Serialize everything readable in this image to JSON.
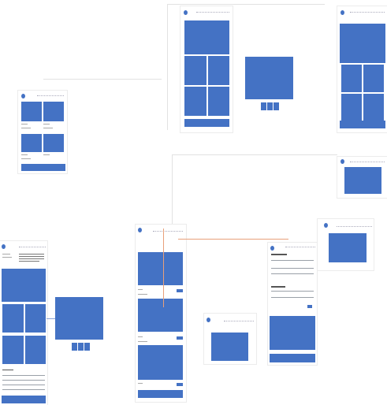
{
  "screens": {
    "top_center_title": "",
    "top_right_title": "",
    "left_title": "",
    "mid_left_title": "",
    "bottom_center_title": "",
    "bottom_left_title": "",
    "right_mid_title": "",
    "right_lower_title": "",
    "right_detail_title": "",
    "small_bottom_title": "",
    "lightbox_left_title": "",
    "lightbox_center_title": ""
  },
  "colors": {
    "block": "#4472c4",
    "connector_orange": "#e8a07a",
    "connector_blue": "#8ea6d8"
  },
  "icons": {
    "logo": "circle-logo-icon"
  }
}
